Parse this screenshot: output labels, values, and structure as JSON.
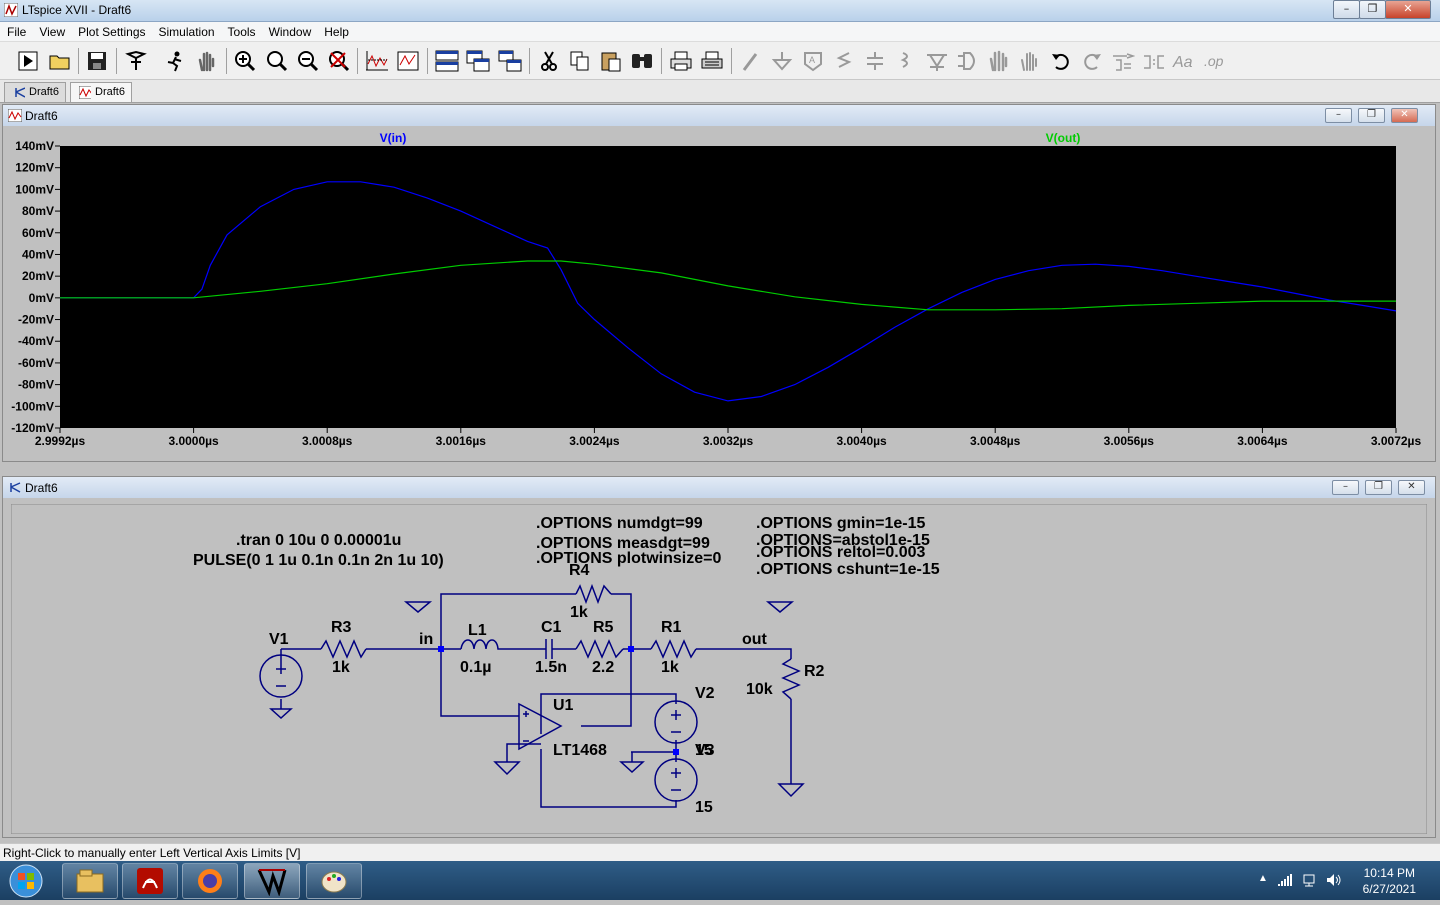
{
  "window": {
    "title": "LTspice XVII - Draft6"
  },
  "menu": [
    "File",
    "View",
    "Plot Settings",
    "Simulation",
    "Tools",
    "Window",
    "Help"
  ],
  "toolbar_icons": [
    "run-icon",
    "open-icon",
    "save-icon",
    "control-panel-icon",
    "halt-icon",
    "pan-icon",
    "zoom-in-icon",
    "zoom-area-icon",
    "zoom-out-icon",
    "zoom-fit-icon",
    "autorange-icon",
    "plot-settings-icon",
    "tile-horizontal-icon",
    "cascade-icon",
    "tile-vertical-icon",
    "cut-icon",
    "copy-icon",
    "paste-icon",
    "find-icon",
    "print-icon",
    "print-preview-icon",
    "wire-icon",
    "ground-icon",
    "label-icon",
    "resistor-icon",
    "capacitor-icon",
    "inductor-icon",
    "diode-icon",
    "component-icon",
    "move-icon",
    "drag-icon",
    "undo-icon",
    "redo-icon",
    "rotate-icon",
    "mirror-icon",
    "text-icon",
    "spice-directive-icon"
  ],
  "tabs": [
    {
      "label": "Draft6",
      "icon": "schematic-icon",
      "active": false
    },
    {
      "label": "Draft6",
      "icon": "waveform-icon",
      "active": true
    }
  ],
  "waveform_window": {
    "title": "Draft6",
    "traces": [
      {
        "name": "V(in)",
        "color": "#0000ff"
      },
      {
        "name": "V(out)",
        "color": "#00cc00"
      }
    ]
  },
  "chart_data": {
    "type": "line",
    "title": "",
    "xlabel": "",
    "ylabel": "",
    "x_ticks": [
      "2.9992µs",
      "3.0000µs",
      "3.0008µs",
      "3.0016µs",
      "3.0024µs",
      "3.0032µs",
      "3.0040µs",
      "3.0048µs",
      "3.0056µs",
      "3.0064µs",
      "3.0072µs"
    ],
    "y_ticks": [
      "140mV",
      "120mV",
      "100mV",
      "80mV",
      "60mV",
      "40mV",
      "20mV",
      "0mV",
      "-20mV",
      "-40mV",
      "-60mV",
      "-80mV",
      "-100mV",
      "-120mV"
    ],
    "xlim": [
      2.9992,
      3.0072
    ],
    "ylim": [
      -120,
      140
    ],
    "background": "#000000",
    "series": [
      {
        "name": "V(in)",
        "color": "#0000ff",
        "x": [
          2.9992,
          3.0,
          3.00005,
          3.0001,
          3.0002,
          3.0004,
          3.0006,
          3.0008,
          3.001,
          3.0012,
          3.0014,
          3.0016,
          3.0018,
          3.002,
          3.00212,
          3.0022,
          3.0023,
          3.0024,
          3.0026,
          3.0028,
          3.003,
          3.0032,
          3.0034,
          3.0036,
          3.0038,
          3.004,
          3.0042,
          3.0044,
          3.0046,
          3.0048,
          3.005,
          3.0052,
          3.0054,
          3.0056,
          3.0058,
          3.006,
          3.0062,
          3.0064,
          3.0066,
          3.0068,
          3.007,
          3.0072
        ],
        "y": [
          0,
          0,
          8,
          30,
          58,
          84,
          100,
          107,
          107,
          102,
          92,
          80,
          66,
          52,
          46,
          26,
          -5,
          -20,
          -46,
          -70,
          -87,
          -95,
          -91,
          -80,
          -64,
          -46,
          -27,
          -10,
          5,
          17,
          25,
          30,
          31,
          29,
          25,
          20,
          15,
          10,
          4,
          -2,
          -7,
          -12
        ]
      },
      {
        "name": "V(out)",
        "color": "#00cc00",
        "x": [
          2.9992,
          3.0,
          3.0004,
          3.0008,
          3.0012,
          3.0016,
          3.002,
          3.0022,
          3.0024,
          3.0028,
          3.0032,
          3.0036,
          3.004,
          3.0044,
          3.0048,
          3.0052,
          3.0056,
          3.006,
          3.0064,
          3.0068,
          3.0072
        ],
        "y": [
          0,
          0,
          6,
          13,
          22,
          30,
          34,
          34,
          31,
          23,
          11,
          1,
          -6,
          -11,
          -11,
          -10,
          -7,
          -5,
          -3,
          -3,
          -3
        ]
      }
    ]
  },
  "schematic_window": {
    "title": "Draft6",
    "directives": {
      "tran": ".tran 0 10u 0 0.00001u",
      "pulse": "PULSE(0 1 1u 0.1n 0.1n 2n 1u 10)",
      "opt1": ".OPTIONS numdgt=99",
      "opt2": ".OPTIONS measdgt=99",
      "opt3": ".OPTIONS plotwinsize=0",
      "opt4": ".OPTIONS gmin=1e-15",
      "opt5": ".OPTIONS=abstol1e-15",
      "opt6": ".OPTIONS reltol=0.003",
      "opt7": ".OPTIONS cshunt=1e-15"
    },
    "labels": {
      "V1": "V1",
      "R3": "R3",
      "R3val": "1k",
      "in": "in",
      "L1": "L1",
      "L1val": "0.1µ",
      "C1": "C1",
      "C1val": "1.5n",
      "R5": "R5",
      "R5val": "2.2",
      "R4": "R4",
      "R4val": "1k",
      "R1": "R1",
      "R1val": "1k",
      "out": "out",
      "R2": "R2",
      "R2val": "10k",
      "U1": "U1",
      "U1part": "LT1468",
      "V2": "V2",
      "V3": "V3",
      "V2val": "15",
      "V3val": "15"
    }
  },
  "status": "Right-Click to manually enter Left Vertical Axis Limits [V]",
  "clock": {
    "time": "10:14 PM",
    "date": "6/27/2021"
  },
  "taskbar_apps": [
    "windows-explorer-icon",
    "acrobat-icon",
    "firefox-icon",
    "ltspice-icon",
    "paint-icon"
  ]
}
